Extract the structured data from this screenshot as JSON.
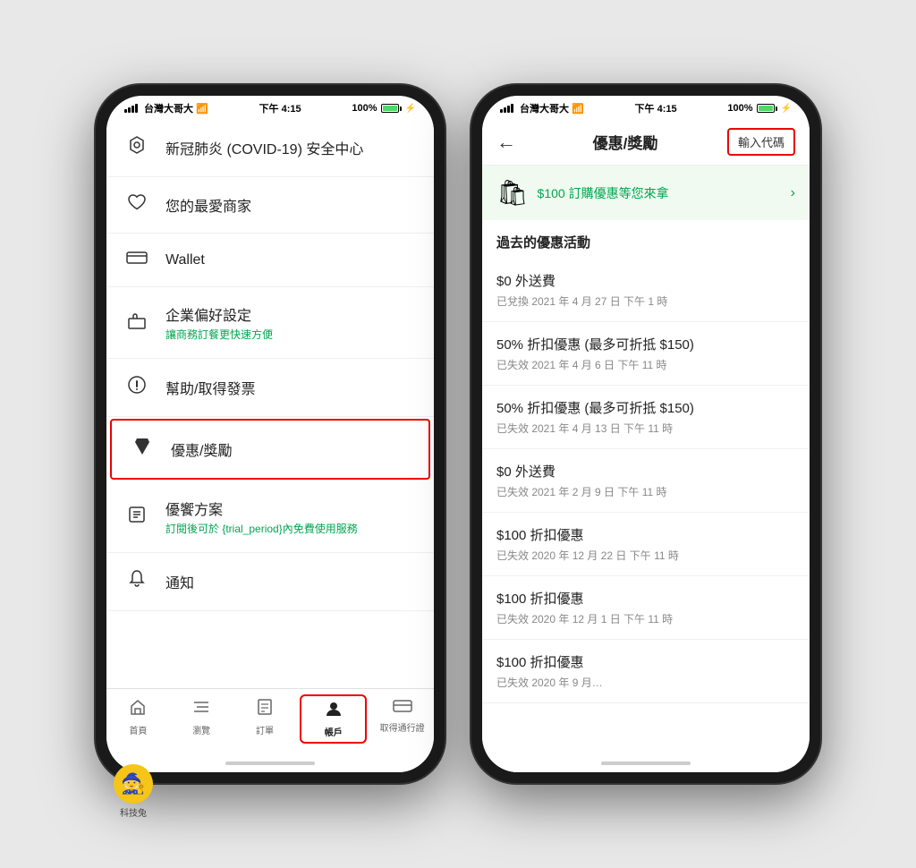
{
  "left_phone": {
    "status_bar": {
      "carrier": "台灣大哥大",
      "time": "下午 4:15",
      "battery": "100%"
    },
    "menu_items": [
      {
        "id": "covid",
        "icon": "🛡",
        "title": "新冠肺炎 (COVID-19) 安全中心",
        "subtitle": "",
        "highlighted": false
      },
      {
        "id": "favorites",
        "icon": "♥",
        "title": "您的最愛商家",
        "subtitle": "",
        "highlighted": false
      },
      {
        "id": "wallet",
        "icon": "▬▬",
        "title": "Wallet",
        "subtitle": "",
        "highlighted": false
      },
      {
        "id": "business",
        "icon": "💼",
        "title": "企業偏好設定",
        "subtitle": "讓商務訂餐更快速方便",
        "highlighted": false
      },
      {
        "id": "help",
        "icon": "🎯",
        "title": "幫助/取得發票",
        "subtitle": "",
        "highlighted": false
      },
      {
        "id": "promo",
        "icon": "🏷",
        "title": "優惠/獎勵",
        "subtitle": "",
        "highlighted": true
      },
      {
        "id": "plan",
        "icon": "📋",
        "title": "優饗方案",
        "subtitle": "訂閱後可於 {trial_period}內免費使用服務",
        "highlighted": false
      },
      {
        "id": "notify",
        "icon": "🔔",
        "title": "通知",
        "subtitle": "",
        "highlighted": false
      }
    ],
    "tab_bar": [
      {
        "id": "home",
        "icon": "⌂",
        "label": "首頁",
        "active": false
      },
      {
        "id": "browse",
        "icon": "☰",
        "label": "瀏覽",
        "active": false
      },
      {
        "id": "orders",
        "icon": "🧾",
        "label": "訂單",
        "active": false
      },
      {
        "id": "account",
        "icon": "👤",
        "label": "帳戶",
        "active": true,
        "highlighted": true
      },
      {
        "id": "pass",
        "icon": "🎫",
        "label": "取得通行證",
        "active": false
      }
    ]
  },
  "right_phone": {
    "status_bar": {
      "carrier": "台灣大哥大",
      "time": "下午 4:15",
      "battery": "100%"
    },
    "header": {
      "back_label": "←",
      "title": "優惠/獎勵",
      "enter_code_label": "輸入代碼"
    },
    "banner": {
      "icon": "🛍",
      "text": "$100 訂購優惠等您來拿",
      "arrow": "›"
    },
    "past_section_title": "過去的優惠活動",
    "promo_items": [
      {
        "title": "$0 外送費",
        "date": "已兌換 2021 年 4 月 27 日 下午 1 時"
      },
      {
        "title": "50% 折扣優惠 (最多可折抵 $150)",
        "date": "已失效 2021 年 4 月 6 日 下午 11 時"
      },
      {
        "title": "50% 折扣優惠 (最多可折抵 $150)",
        "date": "已失效 2021 年 4 月 13 日 下午 11 時"
      },
      {
        "title": "$0 外送費",
        "date": "已失效 2021 年 2 月 9 日 下午 11 時"
      },
      {
        "title": "$100 折扣優惠",
        "date": "已失效 2020 年 12 月 22 日 下午 11 時"
      },
      {
        "title": "$100 折扣優惠",
        "date": "已失效 2020 年 12 月 1 日 下午 11 時"
      },
      {
        "title": "$100 折扣優惠",
        "date": "已失效 2020 年 9 月…"
      }
    ]
  },
  "logo": {
    "icon": "🧙",
    "label": "科技兔"
  }
}
